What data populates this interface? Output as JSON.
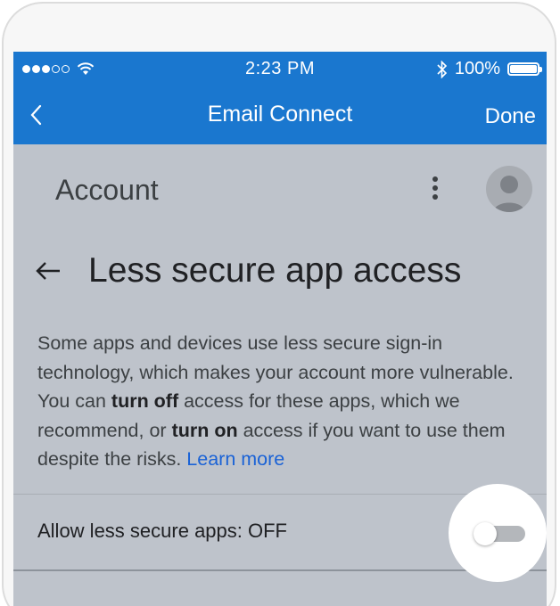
{
  "status_bar": {
    "time": "2:23 PM",
    "battery": "100%",
    "bluetooth_icon": "bluetooth-icon"
  },
  "nav": {
    "back_icon": "chevron-left-icon",
    "title": "Email Connect",
    "done_label": "Done"
  },
  "account": {
    "title": "Account",
    "menu_icon": "more-vert-icon",
    "avatar_icon": "avatar-icon"
  },
  "page": {
    "back_icon": "arrow-back-icon",
    "title": "Less secure app access",
    "desc_1": "Some apps and devices use less secure sign-in technology, which makes your account more vulnerable. You can ",
    "turn_off": "turn off",
    "desc_2": " access for these apps, which we recommend, or ",
    "turn_on": "turn on",
    "desc_3": " access if you want to use them despite the risks. ",
    "learn_more": "Learn more"
  },
  "setting": {
    "label": "Allow less secure apps: OFF",
    "toggle_on": false
  },
  "colors": {
    "accent": "#1a77cf",
    "overlay": "#bec3cb",
    "link": "#1a62d6"
  }
}
